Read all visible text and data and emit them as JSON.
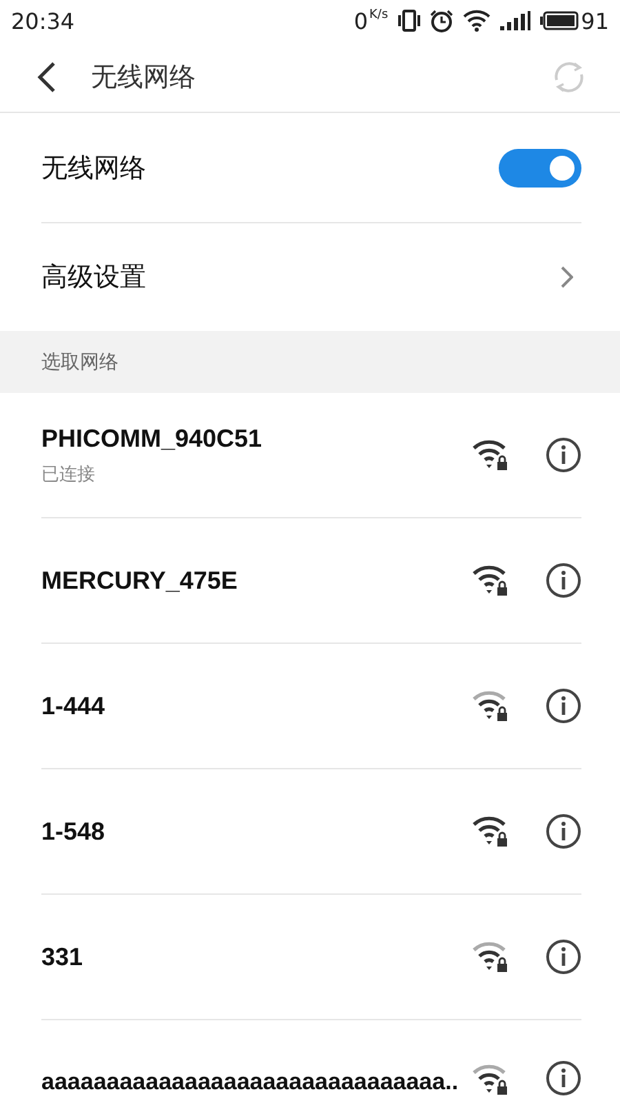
{
  "status_bar": {
    "time": "20:34",
    "speed": "0",
    "speed_unit": "K/s",
    "battery": "91"
  },
  "header": {
    "title": "无线网络"
  },
  "wifi_toggle": {
    "label": "无线网络",
    "on": true
  },
  "advanced": {
    "label": "高级设置"
  },
  "section": {
    "title": "选取网络"
  },
  "networks": [
    {
      "name": "PHICOMM_940C51",
      "status": "已连接",
      "kind": "strong"
    },
    {
      "name": "MERCURY_475E",
      "kind": "strong"
    },
    {
      "name": "1-444",
      "kind": "fair"
    },
    {
      "name": "1-548",
      "kind": "strong"
    },
    {
      "name": "331",
      "kind": "fair"
    },
    {
      "name": "aaaaaaaaaaaaaaaaaaaaaaaaaaaaaaa..",
      "kind": "fair"
    }
  ]
}
